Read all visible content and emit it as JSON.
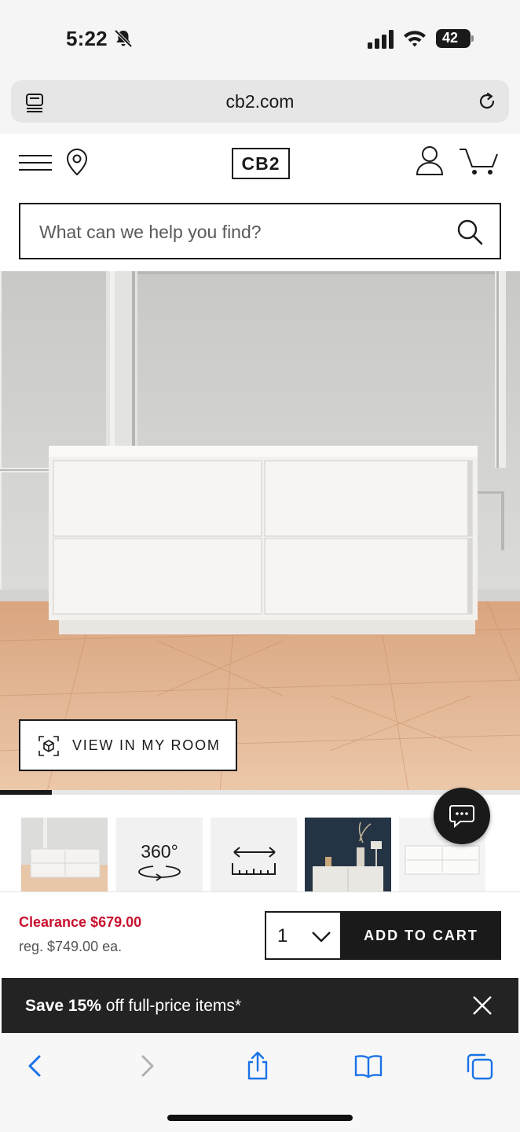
{
  "status_bar": {
    "time": "5:22",
    "battery": "42"
  },
  "browser": {
    "url": "cb2.com"
  },
  "header": {
    "logo": "CB2"
  },
  "search": {
    "placeholder": "What can we help you find?"
  },
  "product": {
    "view_in_room_label": "VIEW IN MY ROOM",
    "gallery_progress": 0.1,
    "thumbnails": [
      {
        "kind": "image",
        "label": "white dresser front view"
      },
      {
        "kind": "360",
        "label": "360°"
      },
      {
        "kind": "dimensions",
        "label": "dimensions"
      },
      {
        "kind": "image",
        "label": "dresser in styled room"
      },
      {
        "kind": "image",
        "label": "white dresser angle"
      }
    ]
  },
  "pricing": {
    "clearance": "Clearance $679.00",
    "regular": "reg. $749.00 ea.",
    "quantity": "1",
    "add_to_cart_label": "ADD TO CART"
  },
  "promo": {
    "bold": "Save 15%",
    "rest": " off full-price items*"
  },
  "colors": {
    "accent_red": "#c8102e",
    "dark": "#1a1a1a"
  }
}
